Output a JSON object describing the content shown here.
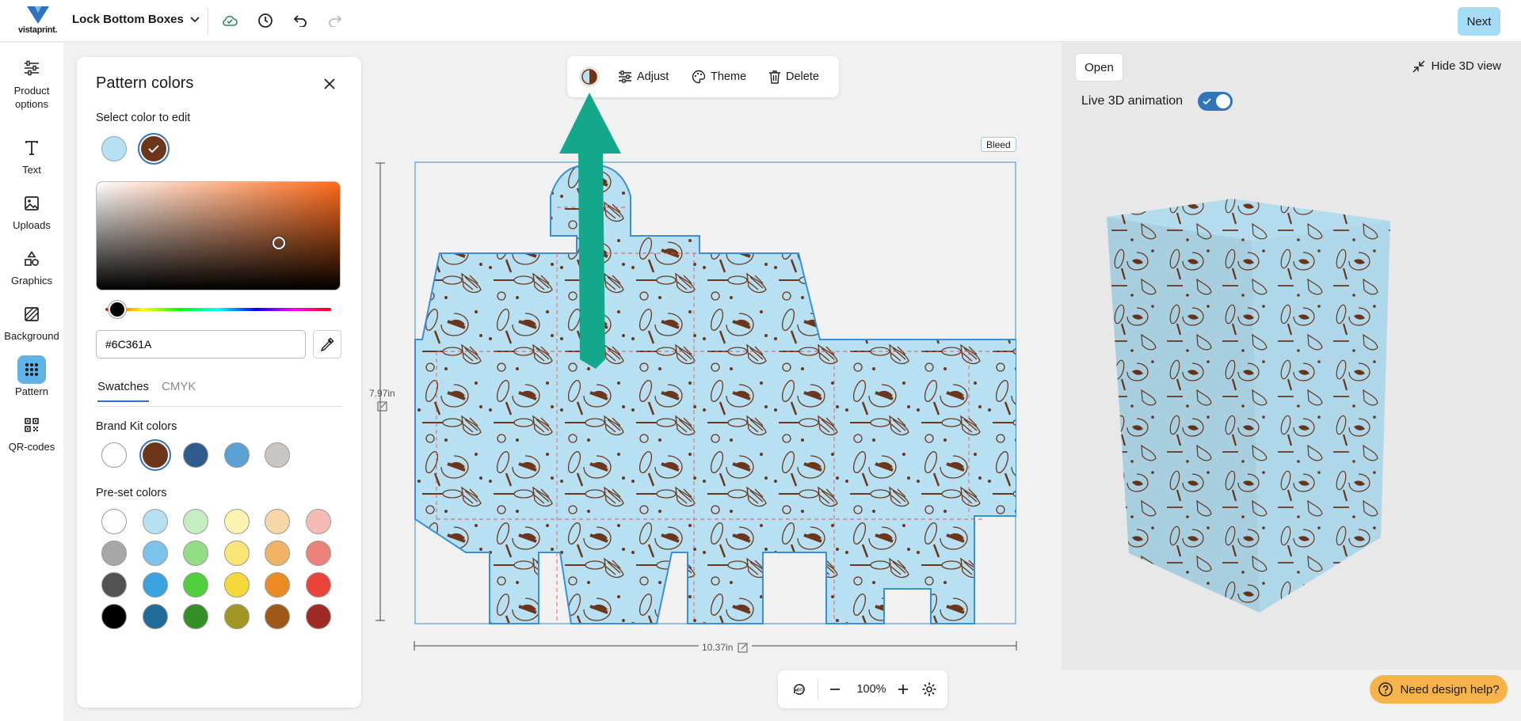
{
  "app": {
    "logo_text": "vistaprint.",
    "document_title": "Lock Bottom Boxes",
    "next_label": "Next"
  },
  "rail": {
    "items": [
      {
        "label": "Product\noptions"
      },
      {
        "label": "Text"
      },
      {
        "label": "Uploads"
      },
      {
        "label": "Graphics"
      },
      {
        "label": "Background"
      },
      {
        "label": "Pattern"
      },
      {
        "label": "QR-codes"
      }
    ]
  },
  "panel": {
    "title": "Pattern colors",
    "select_label": "Select color to edit",
    "selected_colors": [
      "#b7e0f2",
      "#6c361a"
    ],
    "hex_value": "#6C361A",
    "tabs": [
      "Swatches",
      "CMYK"
    ],
    "brand_label": "Brand Kit colors",
    "brand_colors": [
      "#ffffff",
      "#6c361a",
      "#2e5c8c",
      "#5aa0d2",
      "#c9c6c1"
    ],
    "preset_label": "Pre-set colors",
    "preset_colors": [
      [
        "#ffffff",
        "#b7e0f2",
        "#c6ecc1",
        "#fcf3b0",
        "#f7d7a6",
        "#f5bcb6"
      ],
      [
        "#a7a7a7",
        "#7cc3ec",
        "#93dd85",
        "#f9e477",
        "#f1b365",
        "#ec8279"
      ],
      [
        "#525252",
        "#3ba2e0",
        "#52cd3d",
        "#f5d93a",
        "#ec8b23",
        "#e9443a"
      ],
      [
        "#000000",
        "#216b99",
        "#348f27",
        "#a19526",
        "#9f5816",
        "#9d2b23"
      ]
    ]
  },
  "toolbar": {
    "adjust": "Adjust",
    "theme": "Theme",
    "delete": "Delete"
  },
  "canvas": {
    "bleed": "Bleed",
    "height": "7.97in",
    "width": "10.37in",
    "zoom": "100%",
    "pattern_bg": "#b7e0f2",
    "pattern_ink": "#6c361a"
  },
  "view3d": {
    "open": "Open",
    "hide": "Hide 3D view",
    "animation_label": "Live 3D animation",
    "animation_on": true
  },
  "help": {
    "label": "Need design help?"
  }
}
